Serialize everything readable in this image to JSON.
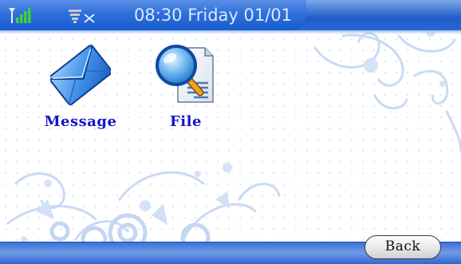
{
  "status_bar": {
    "signal_icon": "signal-strength-icon",
    "network_icon": "network-disconnected-icon",
    "clock": "08:30 Friday 01/01"
  },
  "apps": [
    {
      "label": "Message",
      "icon": "envelope-icon"
    },
    {
      "label": "File",
      "icon": "file-search-icon"
    }
  ],
  "bottom_bar": {
    "back_label": "Back"
  },
  "colors": {
    "bar_blue": "#1f5cc8",
    "label_blue": "#1414c8",
    "decor_blue": "#c9daf3"
  }
}
